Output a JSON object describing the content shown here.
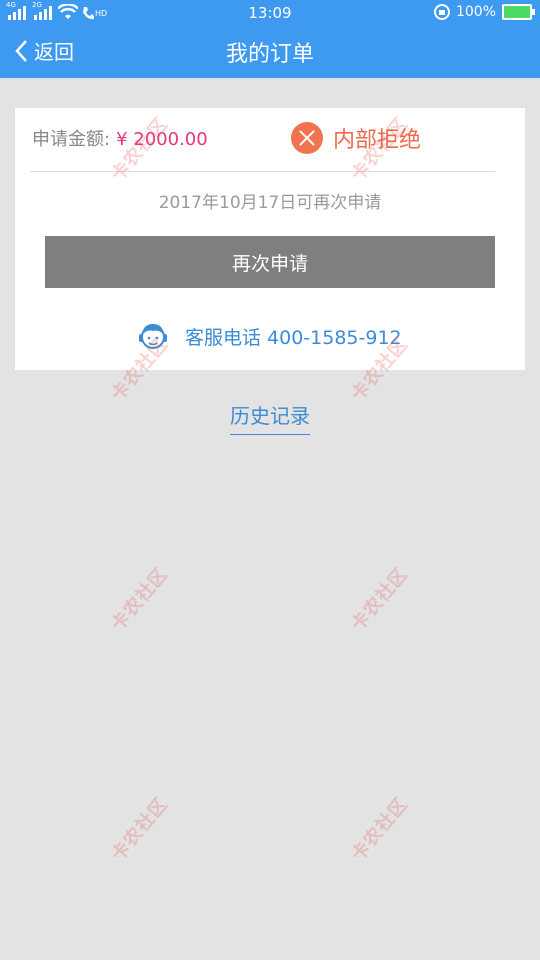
{
  "status_bar": {
    "net1": "4G",
    "net2": "2G",
    "hd": "HD",
    "time": "13:09",
    "battery": "100%"
  },
  "nav": {
    "back_label": "返回",
    "title": "我的订单"
  },
  "order": {
    "amount_label": "申请金额:",
    "amount_value": "¥ 2000.00",
    "status": "内部拒绝",
    "reapply_date": "2017年10月17日可再次申请",
    "reapply_button": "再次申请",
    "service_label": "客服电话 400-1585-912"
  },
  "history_link": "历史记录",
  "watermark": "卡农社区",
  "colors": {
    "header": "#3d9af0",
    "reject": "#f0744f",
    "amount": "#e23a7a",
    "link": "#3d8bd6"
  }
}
